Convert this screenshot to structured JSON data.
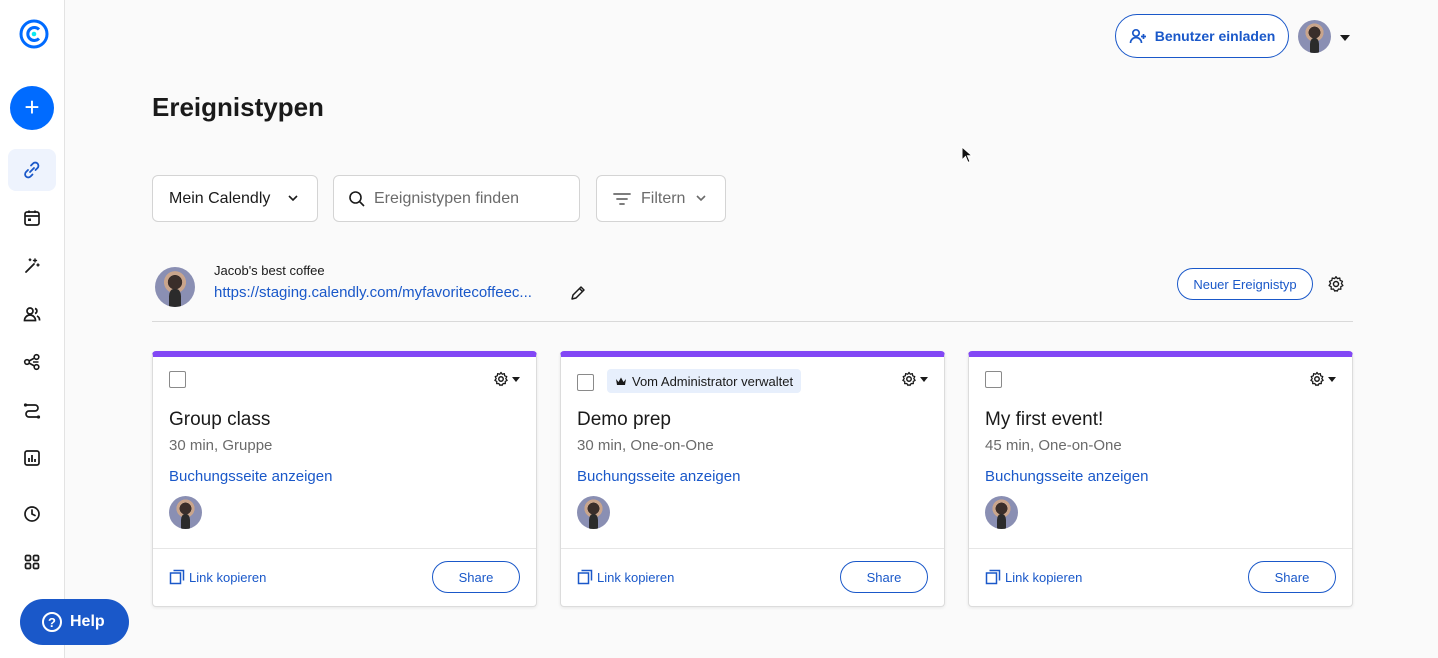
{
  "app": {
    "brand_color": "#006bff",
    "accent_color": "#1a58c9",
    "card_accent": "#8247f5"
  },
  "sidebar": {
    "create_label": "+",
    "items": [
      {
        "icon": "link-icon",
        "active": true
      },
      {
        "icon": "calendar-icon",
        "active": false
      },
      {
        "icon": "magic-wand-icon",
        "active": false
      },
      {
        "icon": "people-icon",
        "active": false
      },
      {
        "icon": "share-nodes-icon",
        "active": false
      },
      {
        "icon": "routing-icon",
        "active": false
      },
      {
        "icon": "analytics-icon",
        "active": false
      },
      {
        "icon": "clock-icon",
        "active": false
      },
      {
        "icon": "apps-grid-icon",
        "active": false
      }
    ],
    "help_label": "Help"
  },
  "header": {
    "invite_label": "Benutzer einladen"
  },
  "page": {
    "title": "Ereignistypen"
  },
  "filters": {
    "scope_value": "Mein Calendly",
    "search_placeholder": "Ereignistypen finden",
    "filter_label": "Filtern"
  },
  "profile": {
    "name": "Jacob's best coffee",
    "link": "https://staging.calendly.com/myfavoritecoffeec...",
    "new_event_label": "Neuer Ereignistyp"
  },
  "cards": [
    {
      "title": "Group class",
      "meta": "30 min, Gruppe",
      "badge": "",
      "booking_label": "Buchungsseite anzeigen",
      "copy_label": "Link kopieren",
      "share_label": "Share"
    },
    {
      "title": "Demo prep",
      "meta": "30 min, One-on-One",
      "badge": "Vom Administrator verwaltet",
      "booking_label": "Buchungsseite anzeigen",
      "copy_label": "Link kopieren",
      "share_label": "Share"
    },
    {
      "title": "My first event!",
      "meta": "45 min, One-on-One",
      "badge": "",
      "booking_label": "Buchungsseite anzeigen",
      "copy_label": "Link kopieren",
      "share_label": "Share"
    }
  ]
}
